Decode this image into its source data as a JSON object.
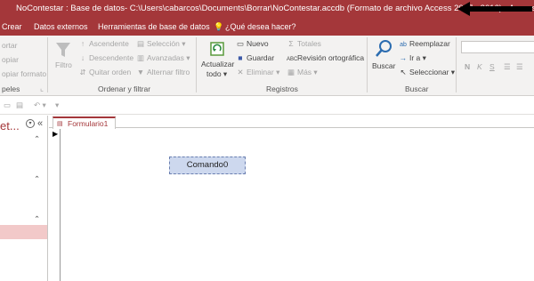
{
  "title_bar": {
    "title": "NoContestar : Base de datos- C:\\Users\\cabarcos\\Documents\\Borrar\\NoContestar.accdb (Formato de archivo Access 2007 - 2016)  -  Access",
    "annotation_arrow": "⟵"
  },
  "menu_bar": {
    "tabs": [
      "Crear",
      "Datos externos",
      "Herramientas de base de datos"
    ],
    "tell_me": "¿Qué desea hacer?"
  },
  "ribbon": {
    "clipboard": {
      "items": [
        "ortar",
        "opiar",
        "opiar formato"
      ],
      "group_label": "peles"
    },
    "sort_filter": {
      "filter_label": "Filtro",
      "ascending": "Ascendente",
      "descending": "Descendente",
      "remove_sort": "Quitar orden",
      "selection": "Selección",
      "advanced": "Avanzadas",
      "toggle_filter": "Alternar filtro",
      "group_label": "Ordenar y filtrar"
    },
    "records": {
      "refresh_line1": "Actualizar",
      "refresh_line2": "todo",
      "new": "Nuevo",
      "save": "Guardar",
      "delete": "Eliminar",
      "totals": "Totales",
      "spelling": "Revisión ortográfica",
      "more": "Más",
      "group_label": "Registros"
    },
    "find": {
      "search_label": "Buscar",
      "replace": "Reemplazar",
      "goto": "Ir a",
      "select": "Seleccionar",
      "group_label": "Buscar"
    },
    "text_format": {
      "buttons": [
        "N",
        "K",
        "S"
      ]
    }
  },
  "nav_pane": {
    "title_fragment": "et..."
  },
  "document": {
    "tab_label": "Formulario1",
    "command_button": "Comando0"
  }
}
